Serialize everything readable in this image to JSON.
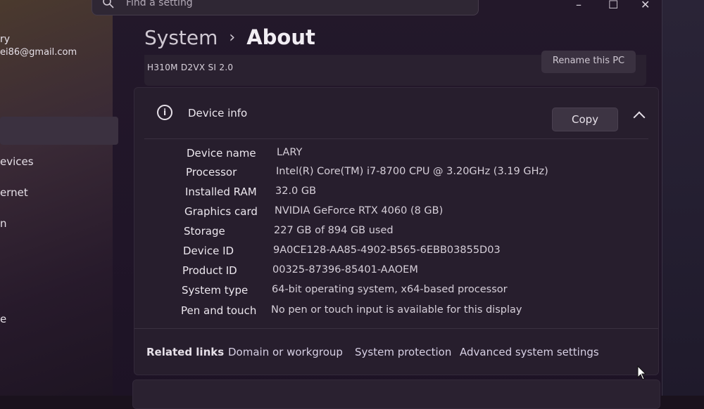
{
  "search": {
    "placeholder": "Find a setting"
  },
  "window_controls": {
    "minimize": "–",
    "maximize": "☐",
    "close": "✕"
  },
  "user": {
    "name_partial": "ry",
    "email_partial": "ei86@gmail.com"
  },
  "sidebar": {
    "items": [
      {
        "label": "evices"
      },
      {
        "label": "ernet"
      },
      {
        "label": "n"
      },
      {
        "label": "e"
      }
    ]
  },
  "breadcrumb": {
    "parent": "System",
    "separator": "›",
    "current": "About"
  },
  "previous_card": {
    "model": "H310M D2VX SI 2.0",
    "rename_button": "Rename this PC"
  },
  "device_info": {
    "title": "Device info",
    "copy_button": "Copy",
    "specs": [
      {
        "key": "Device name",
        "value": "LARY"
      },
      {
        "key": "Processor",
        "value": "Intel(R) Core(TM) i7-8700 CPU @ 3.20GHz (3.19 GHz)"
      },
      {
        "key": "Installed RAM",
        "value": "32.0 GB"
      },
      {
        "key": "Graphics card",
        "value": "NVIDIA GeForce RTX 4060 (8 GB)"
      },
      {
        "key": "Storage",
        "value": "227 GB of 894 GB used"
      },
      {
        "key": "Device ID",
        "value": "9A0CE128-AA85-4902-B565-6EBB03855D03"
      },
      {
        "key": "Product ID",
        "value": "00325-87396-85401-AAOEM"
      },
      {
        "key": "System type",
        "value": "64-bit operating system, x64-based processor"
      },
      {
        "key": "Pen and touch",
        "value": "No pen or touch input is available for this display"
      }
    ]
  },
  "related_links": {
    "label": "Related links",
    "links": [
      "Domain or workgroup",
      "System protection",
      "Advanced system settings"
    ]
  }
}
